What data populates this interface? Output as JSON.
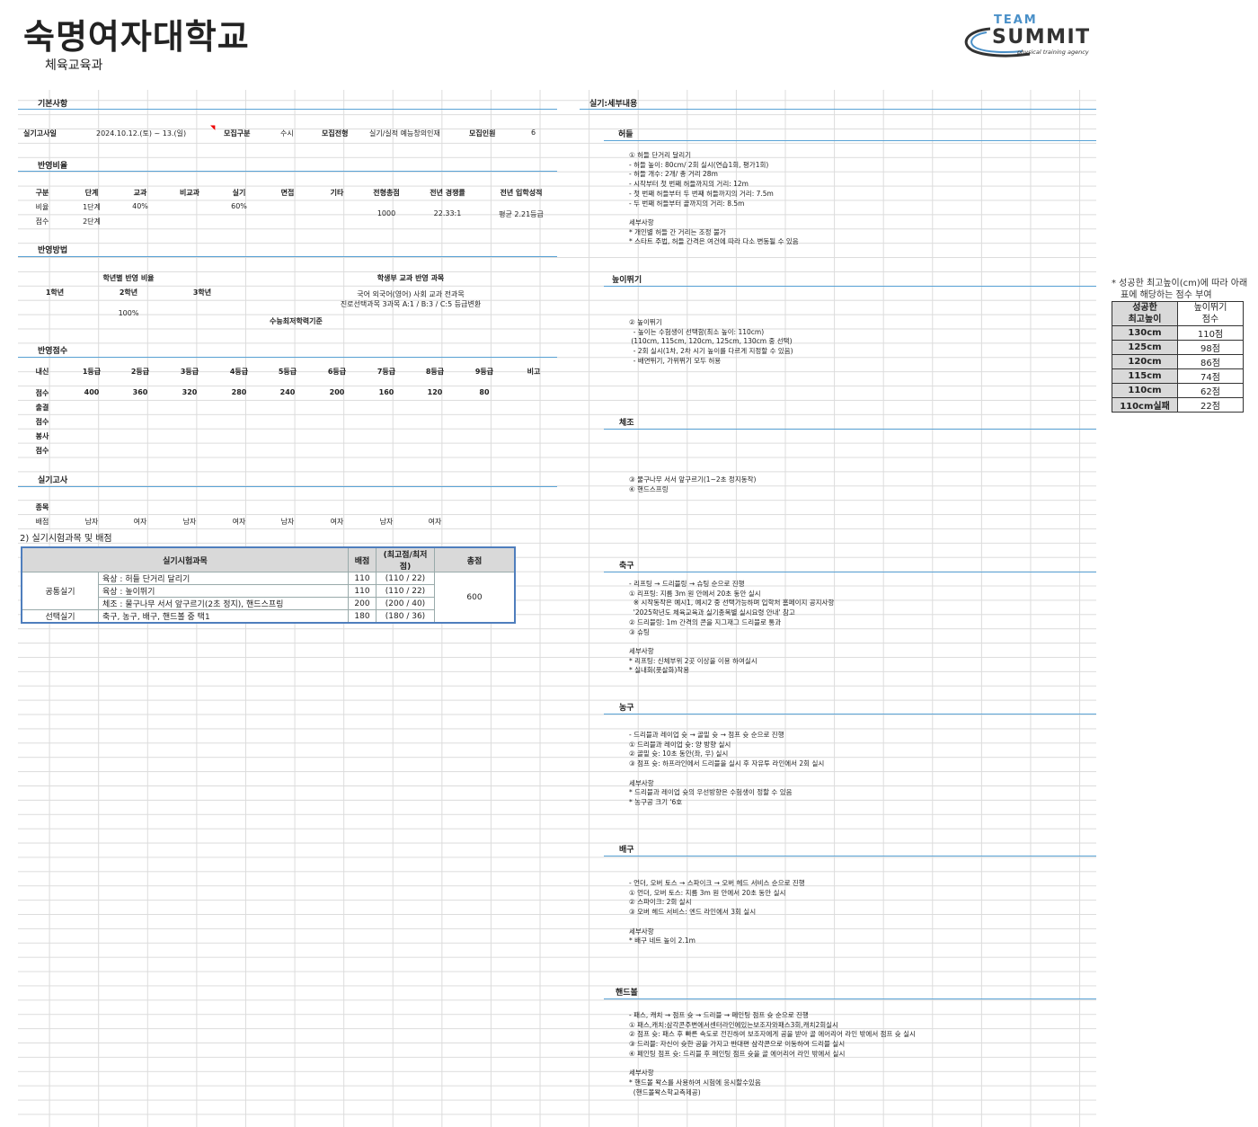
{
  "header": {
    "university": "숙명여자대학교",
    "department": "체육교육과",
    "logo_team": "TEAM",
    "logo_name": "SUMMIT",
    "logo_tagline": "physical training agency"
  },
  "basic": {
    "section": "기본사항",
    "exam_date_label": "실기고사일",
    "exam_date": "2024.10.12.(토) ~ 13.(일)",
    "category_label": "모집구분",
    "category": "수시",
    "type_label": "모집전형",
    "type": "실기/실적 예능창의인재",
    "quota_label": "모집인원",
    "quota": "6"
  },
  "ratio": {
    "section": "반영비율",
    "headers": [
      "구분",
      "단계",
      "교과",
      "비교과",
      "실기",
      "면접",
      "기타",
      "전형총점",
      "전년 경쟁률",
      "전년 입학성적"
    ],
    "row1": [
      "비율",
      "1단계",
      "40%",
      "",
      "60%"
    ],
    "row2": [
      "점수",
      "2단계"
    ],
    "total": "1000",
    "competition": "22.33:1",
    "admission": "평균 2.21등급"
  },
  "method": {
    "section": "반영방법",
    "grade_ratio_title": "학년별 반영 비율",
    "grades": [
      "1학년",
      "2학년",
      "3학년"
    ],
    "grade_value": "100%",
    "subject_title": "학생부 교과 반영 과목",
    "subject_line1": "국어 외국어(영어) 사회 교과 전과목",
    "subject_line2": "진로선택과목 3과목 A:1 / B:3 / C:5 등급변환",
    "suneung": "수능최저학력기준"
  },
  "scores": {
    "section": "반영점수",
    "headers": [
      "내신",
      "1등급",
      "2등급",
      "3등급",
      "4등급",
      "5등급",
      "6등급",
      "7등급",
      "8등급",
      "9등급",
      "비고"
    ],
    "score_label": "점수",
    "values": [
      "400",
      "360",
      "320",
      "280",
      "240",
      "200",
      "160",
      "120",
      "80"
    ],
    "attendance": "출결",
    "score2": "점수",
    "volunteer": "봉사",
    "score3": "점수"
  },
  "practical": {
    "section": "실기고사",
    "item_label": "종목",
    "alloc_label": "배점",
    "genders": [
      "남자",
      "여자",
      "남자",
      "여자",
      "남자",
      "여자",
      "남자",
      "여자"
    ]
  },
  "exam_table": {
    "caption": "2) 실기시험과목 및 배점",
    "headers": [
      "실기시험과목",
      "배점",
      "(최고점/최저점)",
      "총점"
    ],
    "common_label": "공통실기",
    "elective_label": "선택실기",
    "rows": [
      {
        "subject": "육상 : 허들 단거리 달리기",
        "score": "110",
        "range": "(110 / 22)"
      },
      {
        "subject": "육상 : 높이뛰기",
        "score": "110",
        "range": "(110 / 22)"
      },
      {
        "subject": "체조 : 물구나무 서서 앞구르기(2초 정지), 핸드스프링",
        "score": "200",
        "range": "(200 / 40)"
      },
      {
        "subject": "축구, 농구, 배구, 핸드볼 중 택1",
        "score": "180",
        "range": "(180 / 36)"
      }
    ],
    "total": "600"
  },
  "details": {
    "section": "실기:세부내용",
    "hurdle": {
      "title": "허들",
      "text": "① 허들 단거리 달리기\n- 허들 높이: 80cm/ 2회 실시(연습1회, 평가1회)\n- 허들 개수: 2개/ 총 거리 28m\n- 시작부터 첫 번째 허들까지의 거리: 12m\n- 첫 번째 허들부터 두 번째 허들까지의 거리: 7.5m\n- 두 번째 허들부터 끝까지의 거리: 8.5m\n\n세부사항\n* 개인별 허들 간 거리는 조정 불가\n* 스타트 주법, 허들 간격은 여건에 따라 다소 변동될 수 있음"
    },
    "highjump": {
      "title": "높이뛰기",
      "text": "② 높이뛰기\n  - 높이는 수험생이 선택함(최소 높이: 110cm)\n (110cm, 115cm, 120cm, 125cm, 130cm 중 선택)\n  - 2회 실시(1차, 2차 시기 높이를 다르게 지정할 수 있음)\n  - 배면뛰기, 가위뛰기 모두 허용"
    },
    "gym": {
      "title": "체조",
      "text": "③ 물구나무 서서 앞구르기(1~2초 정지동작)\n④ 핸드스프링"
    },
    "soccer": {
      "title": "축구",
      "text": "- 리프팅 → 드리블링 → 슈팅 순으로 진행\n① 리프팅: 지름 3m 원 안에서 20초 동안 실시\n  ※ 시작동작은 예시1, 예시2 중 선택가능하며 입학처 홈페이지 공지사항\n  '2025학년도 체육교육과 실기종목별 실시요령 안내' 참고\n② 드리블링: 1m 간격의 콘을 지그재그 드리블로 통과\n③ 슈팅\n\n세부사항\n* 리프팅: 신체부위 2곳 이상을 이용 하여실시\n* 실내화(풋살화)착용"
    },
    "basketball": {
      "title": "농구",
      "text": "- 드리블과 레이업 슛 → 골밑 슛 → 점프 슛 순으로 진행\n① 드리블과 레이업 슛: 양 방향 실시\n② 골밑 슛: 10초 동안(좌, 우) 실시\n③ 점프 슛: 하프라인에서 드리블을 실시 후 자유투 라인에서 2회 실시\n\n세부사항\n* 드리블과 레이업 슛의 우선방향은 수험생이 정할 수 있음\n* 농구공 크기 '6호"
    },
    "volleyball": {
      "title": "배구",
      "text": "- 언더, 오버 토스 → 스파이크 → 오버 헤드 서비스 순으로 진행\n① 언더, 오버 토스: 지름 3m 원 안에서 20초 동안 실시\n② 스파이크: 2회 실시\n③ 오버 헤드 서비스: 엔드 라인에서 3회 실시\n\n세부사항\n* 배구 네트 높이 2.1m"
    },
    "handball": {
      "title": "핸드볼",
      "text": "- 패스, 캐치 → 점프 슛 → 드리블 → 페인팅 점프 슛 순으로 진행\n① 패스,캐치:삼각콘주변에서센터라인에있는보조자와패스3회,캐치2회실시\n② 점프 슛: 패스 후 빠른 속도로 전진하여 보조자에게 공을 받아 골 에어리어 라인 밖에서 점프 슛 실시\n③ 드리블: 자신이 슛한 공을 가지고 반대편 삼각콘으로 이동하여 드리블 실시\n④ 페인팅 점프 슛: 드리블 후 페인팅 점프 슛을 골 에어리어 라인 밖에서 실시\n\n세부사항\n* 핸드볼 왁스를 사용하여 시험에 응시할수있음\n  (핸드볼왁스학교측제공)"
    }
  },
  "height_scores": {
    "note1": "* 성공한 최고높이(cm)에 따라 아래",
    "note2": "표에 해당하는 점수 부여",
    "h1": "성공한",
    "h1b": "최고높이",
    "h2": "높이뛰기",
    "h2b": "점수",
    "rows": [
      [
        "130cm",
        "110점"
      ],
      [
        "125cm",
        "98점"
      ],
      [
        "120cm",
        "86점"
      ],
      [
        "115cm",
        "74점"
      ],
      [
        "110cm",
        "62점"
      ],
      [
        "110cm실패",
        "22점"
      ]
    ]
  }
}
